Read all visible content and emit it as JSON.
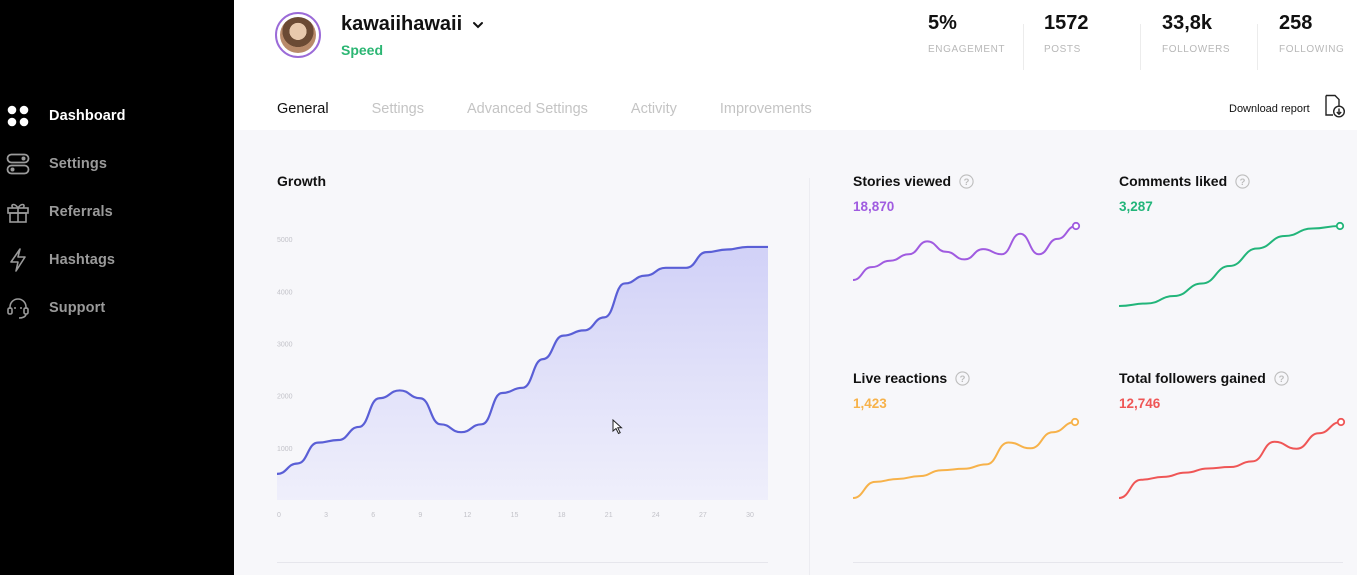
{
  "sidebar": {
    "items": [
      {
        "label": "Dashboard",
        "icon": "grid-icon",
        "active": true
      },
      {
        "label": "Settings",
        "icon": "toggle-icon",
        "active": false
      },
      {
        "label": "Referrals",
        "icon": "gift-icon",
        "active": false
      },
      {
        "label": "Hashtags",
        "icon": "bolt-icon",
        "active": false
      },
      {
        "label": "Support",
        "icon": "headset-icon",
        "active": false
      }
    ]
  },
  "header": {
    "username": "kawaiihawaii",
    "plan": "Speed",
    "stats": [
      {
        "value": "5%",
        "label": "ENGAGEMENT"
      },
      {
        "value": "1572",
        "label": "POSTS"
      },
      {
        "value": "33,8k",
        "label": "FOLLOWERS"
      },
      {
        "value": "258",
        "label": "FOLLOWING"
      }
    ]
  },
  "tabs": [
    "General",
    "Settings",
    "Advanced Settings",
    "Activity",
    "Improvements"
  ],
  "download_label": "Download report",
  "colors": {
    "accent_green": "#2bb673",
    "purple": "#a05be0",
    "green": "#22b57a",
    "orange": "#f7b24a",
    "red": "#ef5656",
    "growth_line": "#5a5fd6"
  },
  "growth": {
    "title": "Growth"
  },
  "chart_data": [
    {
      "type": "area",
      "title": "Growth",
      "x": [
        0,
        3,
        6,
        9,
        12,
        15,
        18,
        21,
        24,
        27,
        30
      ],
      "y_ticks": [
        1000,
        2000,
        3000,
        4000,
        5000
      ],
      "x_ticks": [
        0,
        3,
        6,
        9,
        12,
        15,
        18,
        21,
        24,
        27,
        30
      ],
      "ylim": [
        0,
        5500
      ],
      "points": [
        [
          0,
          500
        ],
        [
          1,
          700
        ],
        [
          2,
          1100
        ],
        [
          3,
          1150
        ],
        [
          4,
          1400
        ],
        [
          5,
          1950
        ],
        [
          6,
          2100
        ],
        [
          7,
          1950
        ],
        [
          8,
          1450
        ],
        [
          9,
          1300
        ],
        [
          10,
          1450
        ],
        [
          11,
          2050
        ],
        [
          12,
          2150
        ],
        [
          13,
          2700
        ],
        [
          14,
          3150
        ],
        [
          15,
          3250
        ],
        [
          16,
          3500
        ],
        [
          17,
          4150
        ],
        [
          18,
          4300
        ],
        [
          19,
          4450
        ],
        [
          20,
          4450
        ],
        [
          21,
          4750
        ],
        [
          22,
          4800
        ],
        [
          23,
          4850
        ],
        [
          24,
          4850
        ]
      ]
    },
    {
      "type": "line",
      "title": "Stories viewed",
      "value": "18,870",
      "points": [
        2,
        3,
        3.5,
        4,
        5,
        4.2,
        3.6,
        4.4,
        4,
        5.6,
        4,
        5.2,
        6.2
      ]
    },
    {
      "type": "line",
      "title": "Comments liked",
      "value": "3,287",
      "points": [
        0,
        0.2,
        0.8,
        1.8,
        3.2,
        4.6,
        5.6,
        6.2,
        6.4
      ]
    },
    {
      "type": "line",
      "title": "Live reactions",
      "value": "1,423",
      "points": [
        0,
        1.1,
        1.3,
        1.5,
        1.9,
        2.0,
        2.3,
        3.8,
        3.4,
        4.5,
        5.2
      ]
    },
    {
      "type": "line",
      "title": "Total followers gained",
      "value": "12,746",
      "points": [
        0,
        1.3,
        1.5,
        1.8,
        2.1,
        2.2,
        2.6,
        4.0,
        3.5,
        4.6,
        5.4
      ]
    }
  ]
}
